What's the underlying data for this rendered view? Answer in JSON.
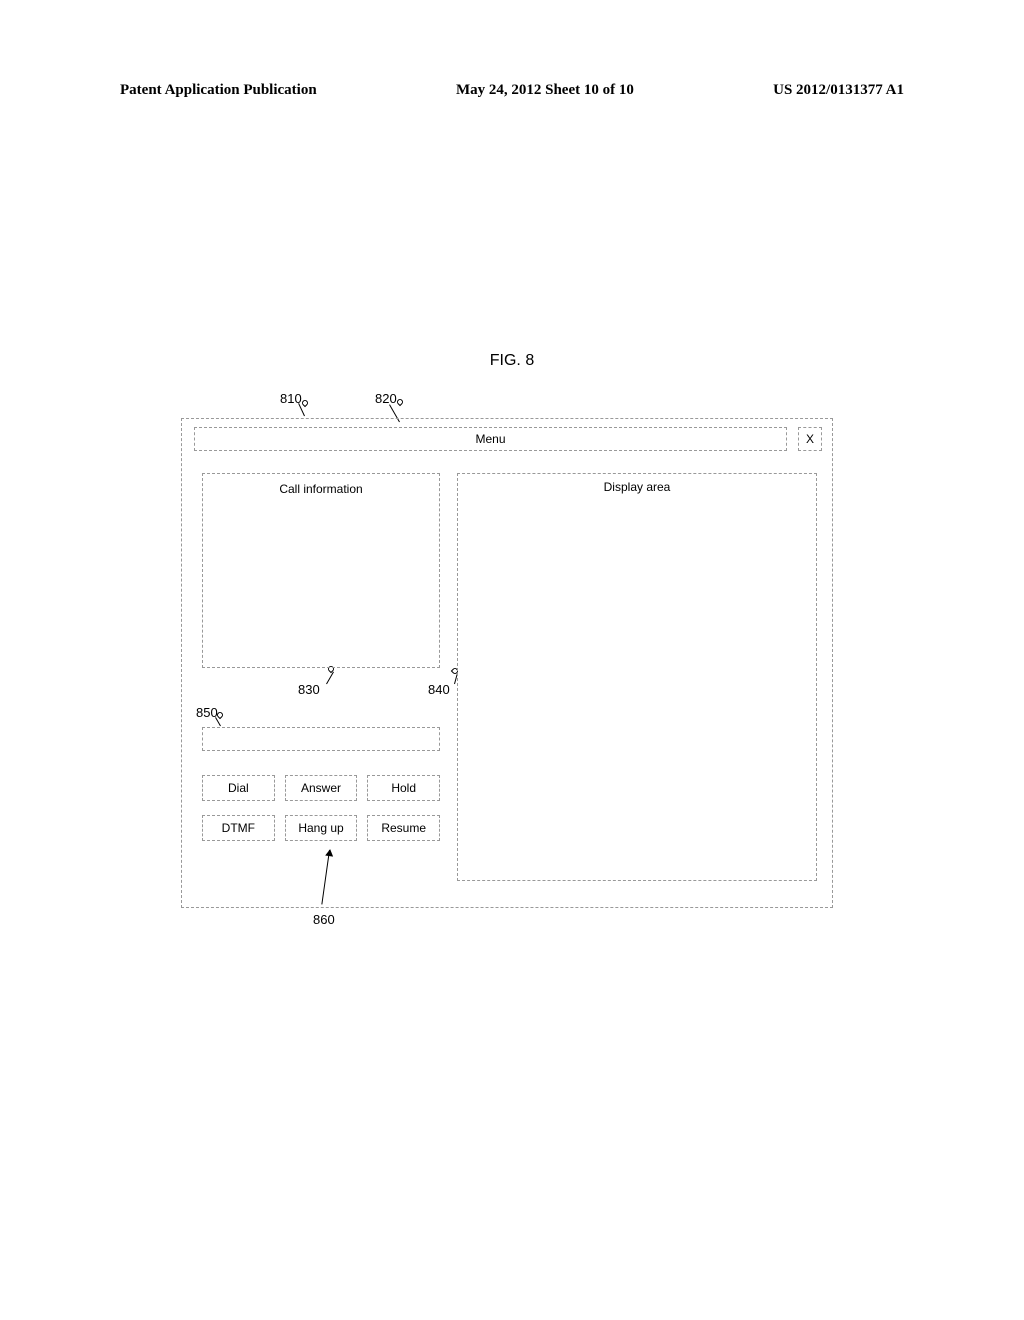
{
  "header": {
    "left": "Patent Application Publication",
    "center": "May 24, 2012  Sheet 10 of 10",
    "right": "US 2012/0131377 A1"
  },
  "figure_title": "FIG. 8",
  "callouts": {
    "c810": "810",
    "c820": "820",
    "c830": "830",
    "c840": "840",
    "c850": "850",
    "c860": "860"
  },
  "ui": {
    "menu_label": "Menu",
    "close_label": "X",
    "call_info_label": "Call information",
    "display_area_label": "Display area",
    "input_value": "",
    "buttons": {
      "dial": "Dial",
      "answer": "Answer",
      "hold": "Hold",
      "dtmf": "DTMF",
      "hangup": "Hang up",
      "resume": "Resume"
    }
  }
}
